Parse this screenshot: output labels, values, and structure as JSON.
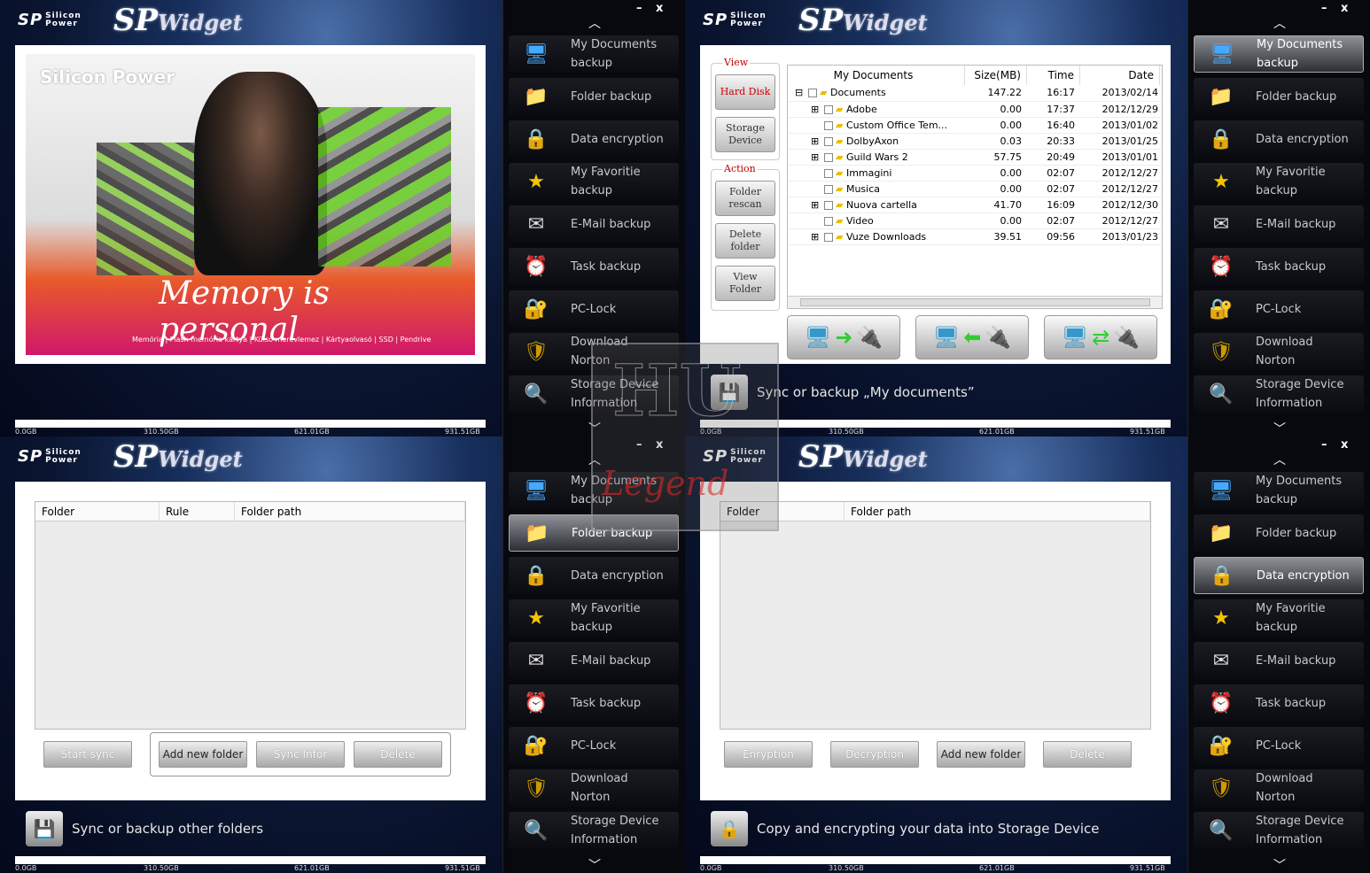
{
  "app": {
    "brand_line1": "Silicon",
    "brand_line2": "Power",
    "sp": "SP",
    "title_sp": "SP",
    "title_widget": "Widget"
  },
  "capacity": [
    "0.0GB",
    "310.50GB",
    "621.01GB",
    "931.51GB"
  ],
  "window_buttons": {
    "minimize": "–",
    "close": "x"
  },
  "sidebar_items": [
    {
      "line1": "My Documents",
      "line2": "backup",
      "icon": "monitor-usb-icon"
    },
    {
      "line1": "Folder backup",
      "line2": "",
      "icon": "folder-icon"
    },
    {
      "line1": "Data encryption",
      "line2": "",
      "icon": "safe-icon"
    },
    {
      "line1": "My Favoritie",
      "line2": "backup",
      "icon": "star-icon"
    },
    {
      "line1": "E-Mail backup",
      "line2": "",
      "icon": "envelope-icon"
    },
    {
      "line1": "Task backup",
      "line2": "",
      "icon": "task-icon"
    },
    {
      "line1": "PC-Lock",
      "line2": "",
      "icon": "lock-icon"
    },
    {
      "line1": "Download",
      "line2": "Norton",
      "icon": "shield-icon"
    },
    {
      "line1": "Storage Device",
      "line2": "Information",
      "icon": "magnifier-icon"
    }
  ],
  "q1": {
    "banner": {
      "brand": "Silicon Power",
      "slogan": "Memory is personal",
      "tags": "Memória | Flash memória kártya | Külső merevlemez | Kártyaolvasó | SSD | Pendrive"
    }
  },
  "q2": {
    "view_label": "View",
    "action_label": "Action",
    "view_buttons": [
      "Hard Disk",
      "Storage Device"
    ],
    "action_buttons": [
      "Folder rescan",
      "Delete folder",
      "View Folder"
    ],
    "columns": [
      "My Documents",
      "Size(MB)",
      "Time",
      "Date"
    ],
    "rows": [
      {
        "name": "Documents",
        "size": "147.22",
        "time": "16:17",
        "date": "2013/02/14",
        "level": 0,
        "exp": "⊟"
      },
      {
        "name": "Adobe",
        "size": "0.00",
        "time": "17:37",
        "date": "2012/12/29",
        "level": 1,
        "exp": "⊞"
      },
      {
        "name": "Custom Office Tem...",
        "size": "0.00",
        "time": "16:40",
        "date": "2013/01/02",
        "level": 1,
        "exp": ""
      },
      {
        "name": "DolbyAxon",
        "size": "0.03",
        "time": "20:33",
        "date": "2013/01/25",
        "level": 1,
        "exp": "⊞"
      },
      {
        "name": "Guild Wars 2",
        "size": "57.75",
        "time": "20:49",
        "date": "2013/01/01",
        "level": 1,
        "exp": "⊞"
      },
      {
        "name": "Immagini",
        "size": "0.00",
        "time": "02:07",
        "date": "2012/12/27",
        "level": 1,
        "exp": ""
      },
      {
        "name": "Musica",
        "size": "0.00",
        "time": "02:07",
        "date": "2012/12/27",
        "level": 1,
        "exp": ""
      },
      {
        "name": "Nuova cartella",
        "size": "41.70",
        "time": "16:09",
        "date": "2012/12/30",
        "level": 1,
        "exp": "⊞"
      },
      {
        "name": "Video",
        "size": "0.00",
        "time": "02:07",
        "date": "2012/12/27",
        "level": 1,
        "exp": ""
      },
      {
        "name": "Vuze Downloads",
        "size": "39.51",
        "time": "09:56",
        "date": "2013/01/23",
        "level": 1,
        "exp": "⊞"
      }
    ],
    "footer": "Sync or backup „My documents”"
  },
  "q3": {
    "columns": [
      "Folder",
      "Rule",
      "Folder path"
    ],
    "buttons": [
      "Start sync",
      "Add new folder",
      "Sync Infor",
      "Delete"
    ],
    "footer": "Sync or backup other folders"
  },
  "q4": {
    "columns": [
      "Folder",
      "Folder path"
    ],
    "buttons": [
      "Enryption",
      "Decryption",
      "Add new folder",
      "Delete"
    ],
    "footer": "Copy and encrypting your data into Storage Device"
  },
  "watermark": {
    "top": "HU",
    "bottom": "Legend"
  }
}
